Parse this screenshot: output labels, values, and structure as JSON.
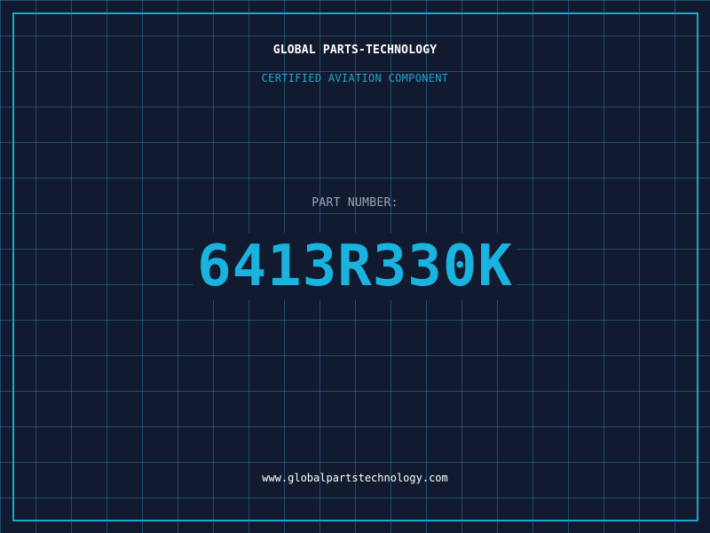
{
  "header": {
    "company": "GLOBAL PARTS-TECHNOLOGY",
    "subtitle": "CERTIFIED AVIATION COMPONENT"
  },
  "part": {
    "label": "PART NUMBER:",
    "number": "6413R330K"
  },
  "footer": {
    "website": "www.globalpartstechnology.com"
  },
  "colors": {
    "background": "#111a2e",
    "grid": "#26789f",
    "accent": "#1ab2de",
    "frame": "#1da5cc",
    "label": "#9aa7b8",
    "text": "#ffffff"
  }
}
